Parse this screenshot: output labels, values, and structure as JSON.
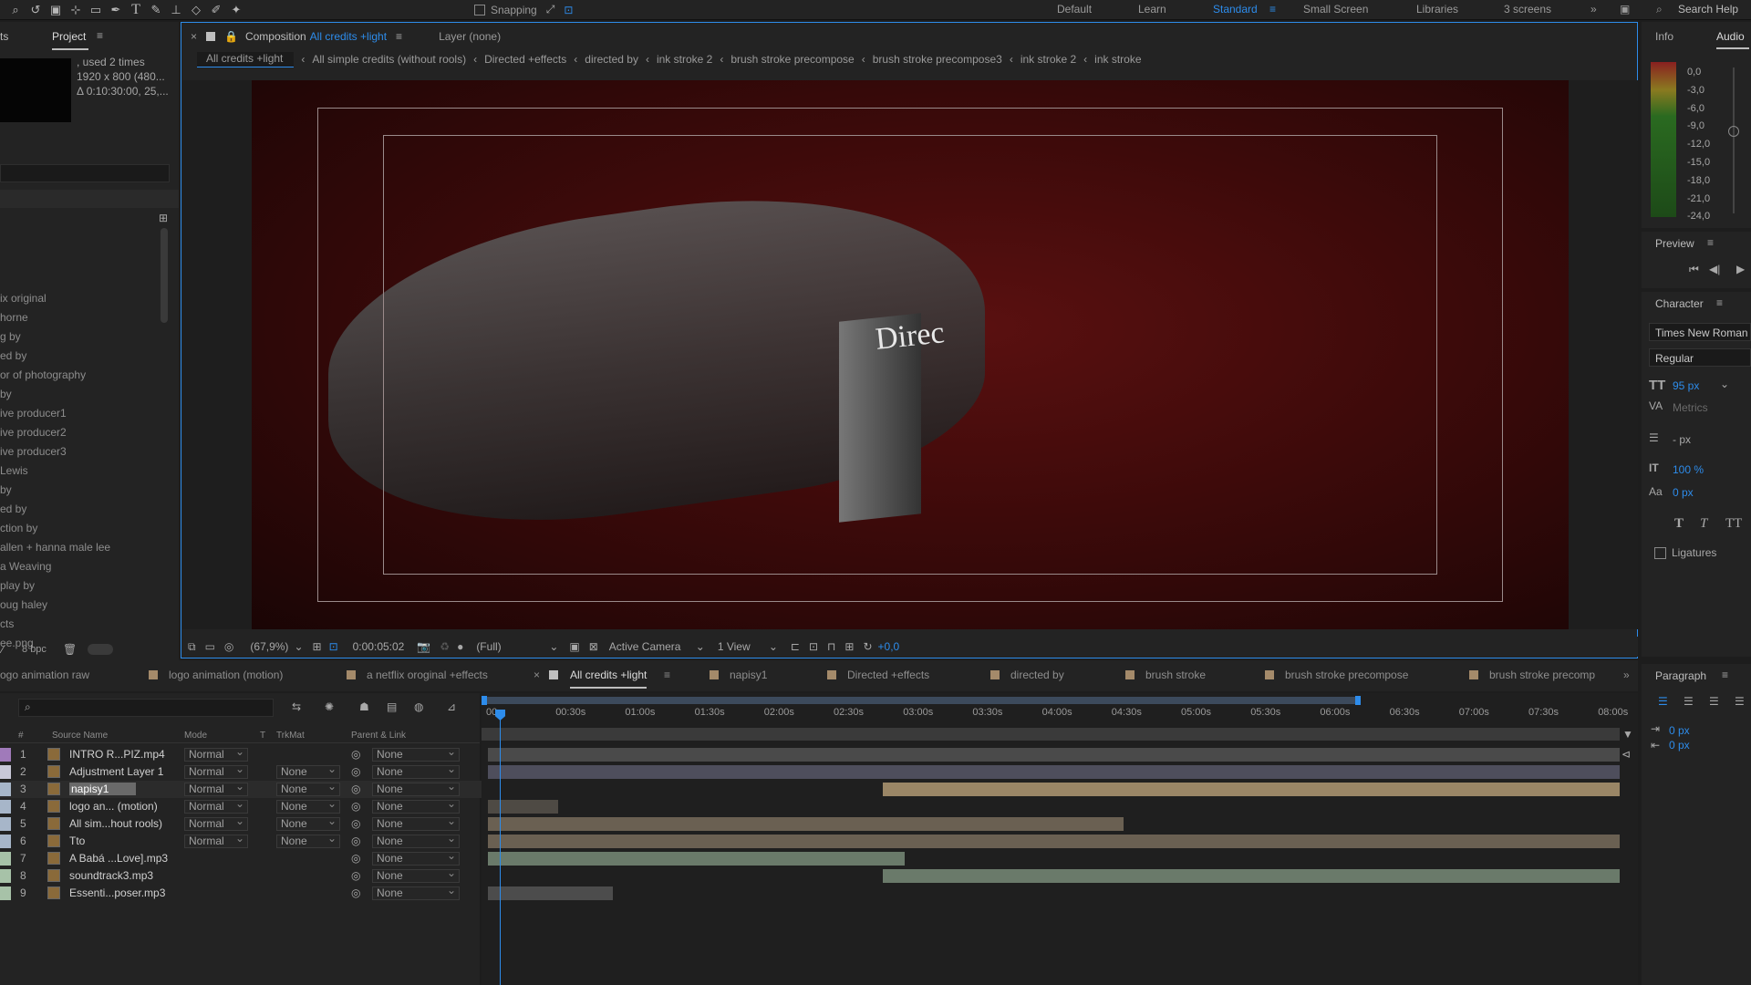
{
  "toolbar": {
    "snapping": "Snapping",
    "workspaces": [
      "Default",
      "Learn",
      "Standard",
      "Small Screen",
      "Libraries",
      "3 screens"
    ],
    "search_help": "Search Help"
  },
  "project": {
    "tab_left": "ts",
    "title": "Project",
    "info_lines": [
      ", used 2 times",
      "1920 x 800  (480...",
      "Δ 0:10:30:00, 25,..."
    ],
    "items": [
      "ix original",
      "horne",
      "g by",
      "ed by",
      "or of photography",
      "by",
      "ive producer1",
      "ive producer2",
      "ive producer3",
      "Lewis",
      "by",
      "ed by",
      "ction by",
      "allen + hanna male lee",
      "a Weaving",
      "play by",
      "oug haley",
      "cts",
      "ee.png"
    ],
    "bpc": "8 bpc"
  },
  "comp": {
    "tab_prefix": "Composition",
    "tab_name": "All credits +light",
    "layer_label": "Layer (none)",
    "breadcrumbs": [
      "All credits +light",
      "All simple credits (without rools)",
      "Directed +effects",
      "directed by",
      "ink stroke 2",
      "brush stroke precompose",
      "brush stroke precompose3",
      "ink stroke 2",
      "ink stroke"
    ],
    "overlay_text": "Direc",
    "zoom": "(67,9%)",
    "timecode": "0:00:05:02",
    "resolution": "(Full)",
    "camera": "Active Camera",
    "views": "1 View",
    "exposure": "+0,0"
  },
  "info": {
    "tab_info": "Info",
    "tab_audio": "Audio",
    "levels": [
      "0,0",
      "-3,0",
      "-6,0",
      "-9,0",
      "-12,0",
      "-15,0",
      "-18,0",
      "-21,0",
      "-24,0"
    ]
  },
  "preview": {
    "title": "Preview"
  },
  "character": {
    "title": "Character",
    "font": "Times New Roman",
    "style": "Regular",
    "size": "95 px",
    "kerning": "Metrics",
    "leading": "- px",
    "vscale": "100 %",
    "baseline": "0 px",
    "ligatures": "Ligatures"
  },
  "paragraph": {
    "title": "Paragraph",
    "indent1": "0 px",
    "indent2": "0 px"
  },
  "timeline": {
    "tabs": [
      "ogo animation raw",
      "logo animation (motion)",
      "a netflix oroginal +effects",
      "All credits +light",
      "napisy1",
      "Directed +effects",
      "directed by",
      "brush stroke",
      "brush stroke precompose",
      "brush stroke precomp"
    ],
    "headers": {
      "num": "#",
      "source": "Source Name",
      "mode": "Mode",
      "t": "T",
      "trkmat": "TrkMat",
      "parent": "Parent & Link"
    },
    "ticks": [
      "00s",
      "00:30s",
      "01:00s",
      "01:30s",
      "02:00s",
      "02:30s",
      "03:00s",
      "03:30s",
      "04:00s",
      "04:30s",
      "05:00s",
      "05:30s",
      "06:00s",
      "06:30s",
      "07:00s",
      "07:30s",
      "08:00s"
    ],
    "layers": [
      {
        "n": "1",
        "name": "INTRO R...PIZ.mp4",
        "mode": "Normal",
        "trk": "",
        "parent": "None"
      },
      {
        "n": "2",
        "name": "Adjustment Layer 1",
        "mode": "Normal",
        "trk": "None",
        "parent": "None"
      },
      {
        "n": "3",
        "name": "napisy1",
        "mode": "Normal",
        "trk": "None",
        "parent": "None"
      },
      {
        "n": "4",
        "name": "logo an... (motion)",
        "mode": "Normal",
        "trk": "None",
        "parent": "None"
      },
      {
        "n": "5",
        "name": "All sim...hout rools)",
        "mode": "Normal",
        "trk": "None",
        "parent": "None"
      },
      {
        "n": "6",
        "name": "Tto",
        "mode": "Normal",
        "trk": "None",
        "parent": "None"
      },
      {
        "n": "7",
        "name": "A Babá ...Love].mp3",
        "mode": "",
        "trk": "",
        "parent": "None"
      },
      {
        "n": "8",
        "name": "soundtrack3.mp3",
        "mode": "",
        "trk": "",
        "parent": "None"
      },
      {
        "n": "9",
        "name": "Essenti...poser.mp3",
        "mode": "",
        "trk": "",
        "parent": "None"
      }
    ]
  }
}
